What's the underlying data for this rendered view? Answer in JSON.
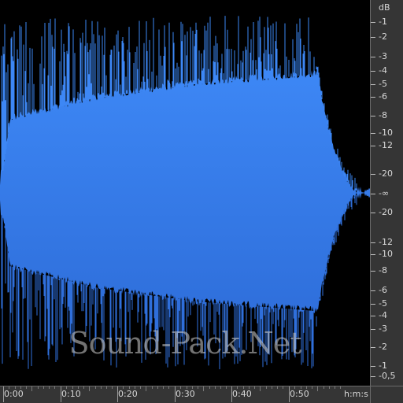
{
  "waveform": {
    "color": "#3d87f5",
    "color_dark": "#2f6fdb",
    "background": "#000000",
    "duration_seconds": 57.5,
    "envelope": {
      "attack_end_seconds": 1.2,
      "sustain_end_seconds": 54.8,
      "fade_end_seconds": 63.0
    }
  },
  "db_ruler": {
    "unit": "dB",
    "labels": [
      "-1",
      "-2",
      "-3",
      "-4",
      "-5",
      "-6",
      "-8",
      "-10",
      "-12",
      "-20",
      "-∞",
      "-20",
      "-12",
      "-10",
      "-8",
      "-6",
      "-5",
      "-4",
      "-3",
      "-2",
      "-1",
      "-0,5"
    ]
  },
  "time_ruler": {
    "unit": "h:m:s",
    "labels": [
      "0:00",
      "0:10",
      "0:20",
      "0:30",
      "0:40",
      "0:50"
    ]
  },
  "watermark": "Sound-Pack.Net"
}
